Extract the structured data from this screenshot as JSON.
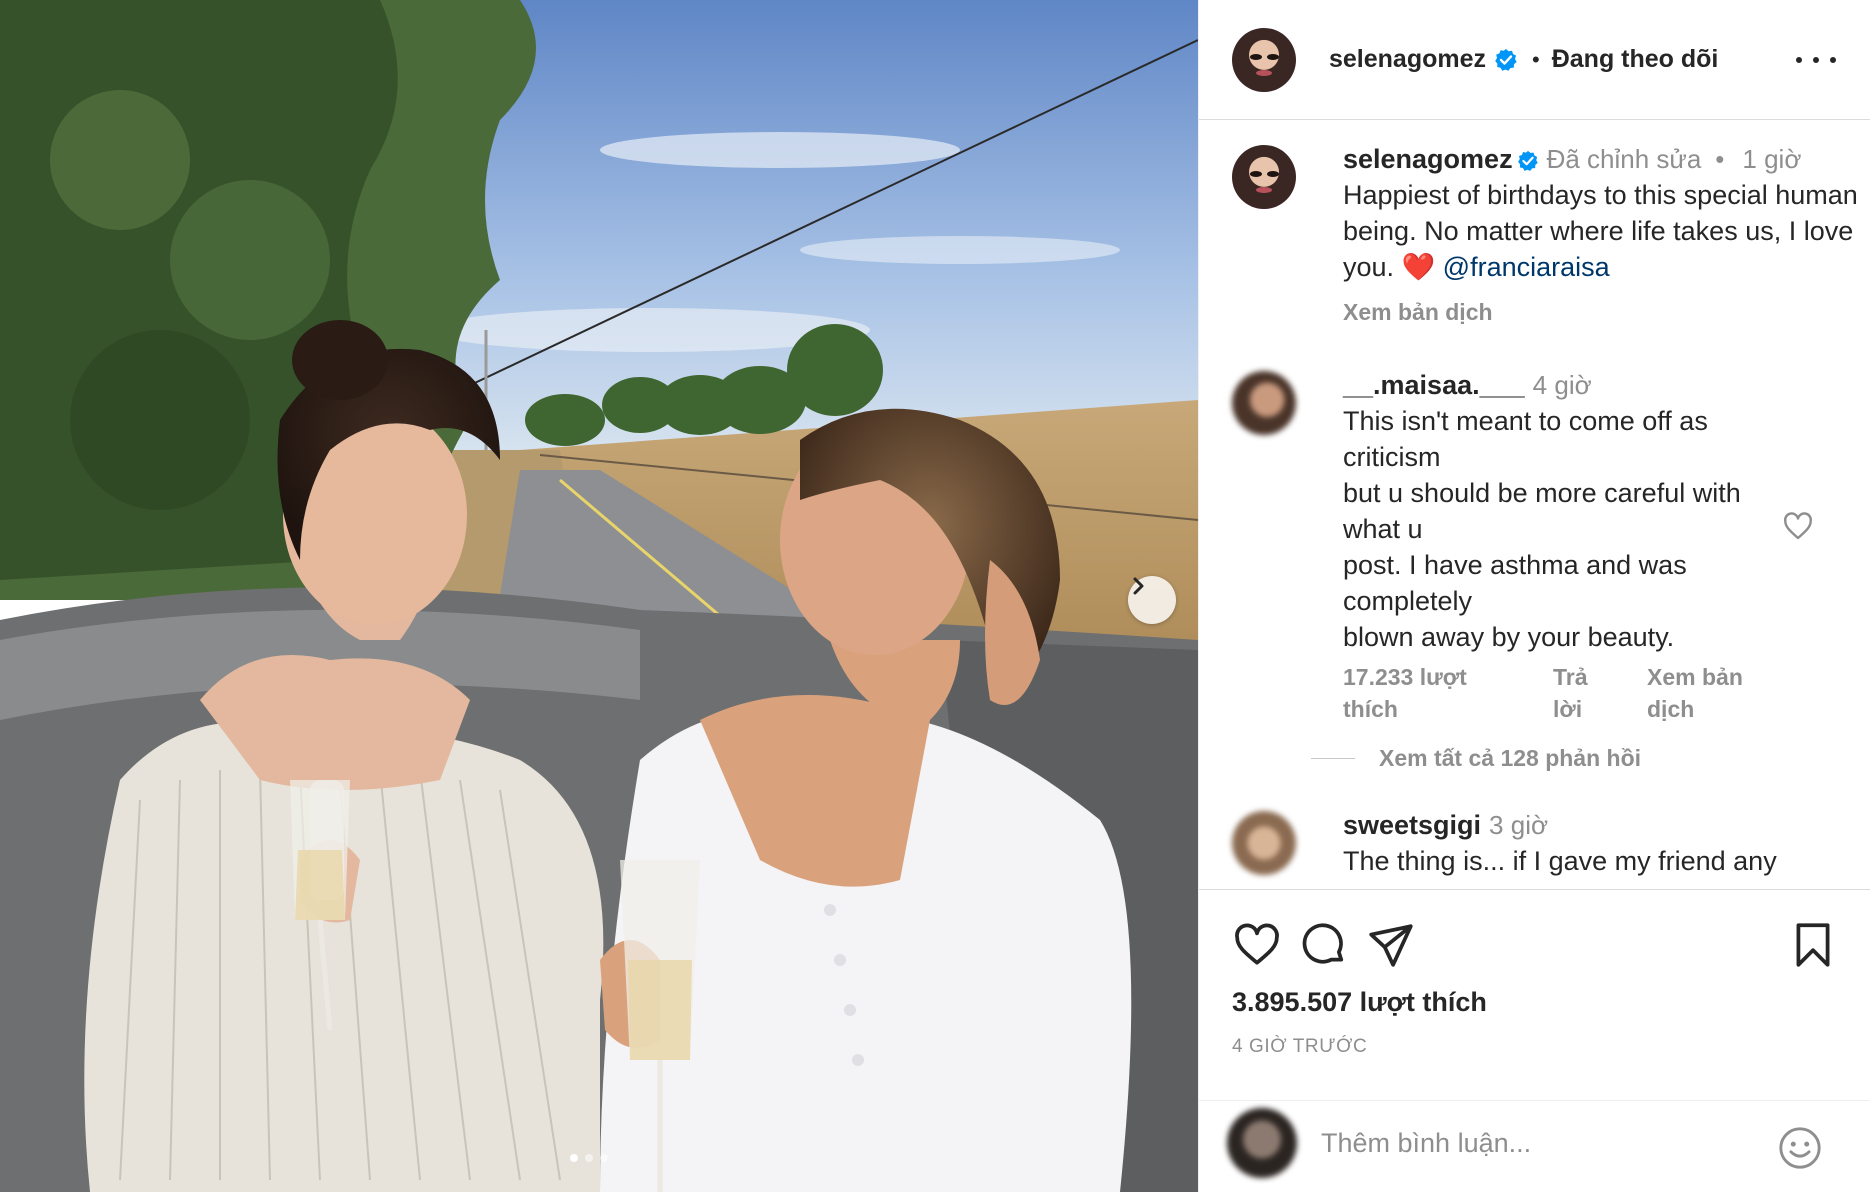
{
  "post": {
    "username": "selenagomez",
    "follow_status": "Đang theo dõi",
    "separator": "•",
    "more_icon": "more-horizontal-icon"
  },
  "caption": {
    "username": "selenagomez",
    "edited": "Đã chỉnh sửa",
    "dot": "•",
    "time": "1 giờ",
    "text": "Happiest of birthdays to this special human being. No matter where life takes us, I love you. ❤️",
    "mention": "@franciaraisa",
    "translate": "Xem bản dịch"
  },
  "comments": [
    {
      "username": "__.maisaa.___",
      "time": "4 giờ",
      "lines": [
        "This isn't meant to come off as",
        "criticism",
        "but u should be more careful with",
        "what u",
        "post. I have asthma and was",
        "completely",
        "blown away by your beauty."
      ],
      "likes_line1": "17.233 lượt",
      "likes_line2": "thích",
      "reply_line1": "Trả",
      "reply_line2": "lời",
      "translate_line1": "Xem bản",
      "translate_line2": "dịch",
      "view_replies": "Xem tất cả 128 phản hồi"
    },
    {
      "username": "sweetsgigi",
      "time": "3 giờ",
      "text": "The thing is... if I gave my friend any"
    }
  ],
  "actions": {
    "like_icon": "heart-icon",
    "comment_icon": "comment-icon",
    "share_icon": "send-icon",
    "save_icon": "bookmark-icon"
  },
  "likes_count": "3.895.507 lượt thích",
  "posted_time": "4 GIỜ TRƯỚC",
  "add_comment": {
    "placeholder": "Thêm bình luận...",
    "emoji_icon": "emoji-icon"
  },
  "carousel": {
    "current": 1,
    "total": 3
  },
  "colors": {
    "verified": "#0095f6",
    "mention": "#00376b",
    "secondary_text": "#8e8e8e"
  }
}
